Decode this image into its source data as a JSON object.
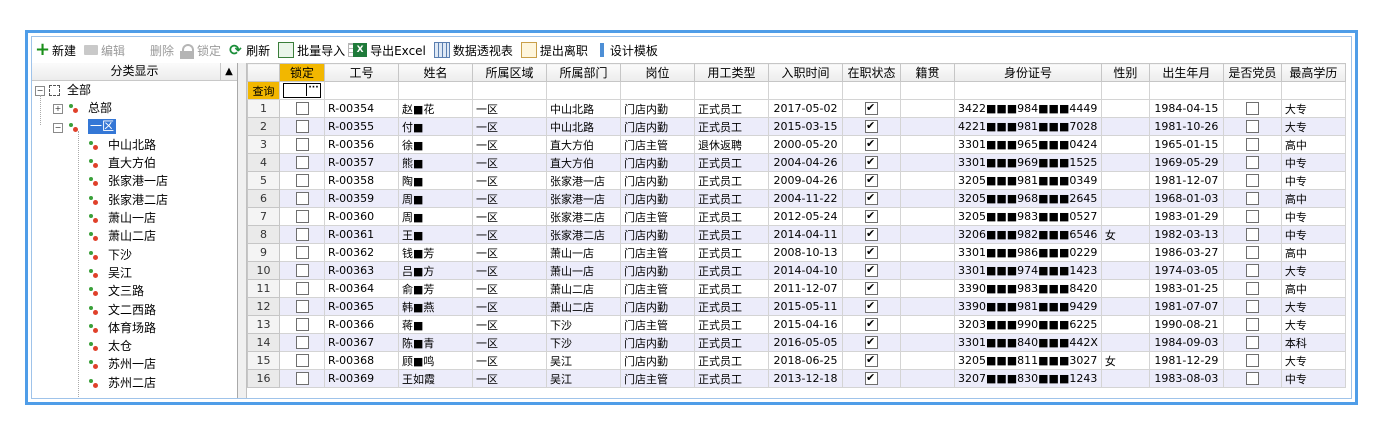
{
  "toolbar": {
    "new": "新建",
    "edit": "编辑",
    "delete": "删除",
    "lock": "锁定",
    "refresh": "刷新",
    "import": "批量导入",
    "export": "导出Excel",
    "pivot": "数据透视表",
    "leave": "提出离职",
    "template": "设计模板"
  },
  "tree": {
    "header": "分类显示",
    "root": "全部",
    "hq": "总部",
    "region1": "一区",
    "stores": [
      "中山北路",
      "直大方伯",
      "张家港一店",
      "张家港二店",
      "萧山一店",
      "萧山二店",
      "下沙",
      "吴江",
      "文三路",
      "文二西路",
      "体育场路",
      "太仓",
      "苏州一店",
      "苏州二店"
    ]
  },
  "grid": {
    "columns": [
      "锁定",
      "工号",
      "姓名",
      "所属区域",
      "所属部门",
      "岗位",
      "用工类型",
      "入职时间",
      "在职状态",
      "籍贯",
      "身份证号",
      "性别",
      "出生年月",
      "是否党员",
      "最高学历"
    ],
    "query_label": "查询",
    "rows": [
      {
        "n": "1",
        "id": "R-00354",
        "name": "赵■花",
        "region": "一区",
        "dept": "中山北路",
        "post": "门店内勤",
        "type": "正式员工",
        "date": "2017-05-02",
        "active": true,
        "native": "",
        "idno": "3422■■■984■■■4449",
        "sex": "",
        "birth": "1984-04-15",
        "party": false,
        "edu": "大专"
      },
      {
        "n": "2",
        "id": "R-00355",
        "name": "付■",
        "region": "一区",
        "dept": "中山北路",
        "post": "门店内勤",
        "type": "正式员工",
        "date": "2015-03-15",
        "active": true,
        "native": "",
        "idno": "4221■■■981■■■7028",
        "sex": "",
        "birth": "1981-10-26",
        "party": false,
        "edu": "大专"
      },
      {
        "n": "3",
        "id": "R-00356",
        "name": "徐■",
        "region": "一区",
        "dept": "直大方伯",
        "post": "门店主管",
        "type": "退休返聘",
        "date": "2000-05-20",
        "active": true,
        "native": "",
        "idno": "3301■■■965■■■0424",
        "sex": "",
        "birth": "1965-01-15",
        "party": false,
        "edu": "高中"
      },
      {
        "n": "4",
        "id": "R-00357",
        "name": "熊■",
        "region": "一区",
        "dept": "直大方伯",
        "post": "门店内勤",
        "type": "正式员工",
        "date": "2004-04-26",
        "active": true,
        "native": "",
        "idno": "3301■■■969■■■1525",
        "sex": "",
        "birth": "1969-05-29",
        "party": false,
        "edu": "中专"
      },
      {
        "n": "5",
        "id": "R-00358",
        "name": "陶■",
        "region": "一区",
        "dept": "张家港一店",
        "post": "门店内勤",
        "type": "正式员工",
        "date": "2009-04-26",
        "active": true,
        "native": "",
        "idno": "3205■■■981■■■0349",
        "sex": "",
        "birth": "1981-12-07",
        "party": false,
        "edu": "中专"
      },
      {
        "n": "6",
        "id": "R-00359",
        "name": "周■",
        "region": "一区",
        "dept": "张家港一店",
        "post": "门店内勤",
        "type": "正式员工",
        "date": "2004-11-22",
        "active": true,
        "native": "",
        "idno": "3205■■■968■■■2645",
        "sex": "",
        "birth": "1968-01-03",
        "party": false,
        "edu": "高中"
      },
      {
        "n": "7",
        "id": "R-00360",
        "name": "周■",
        "region": "一区",
        "dept": "张家港二店",
        "post": "门店主管",
        "type": "正式员工",
        "date": "2012-05-24",
        "active": true,
        "native": "",
        "idno": "3205■■■983■■■0527",
        "sex": "",
        "birth": "1983-01-29",
        "party": false,
        "edu": "中专"
      },
      {
        "n": "8",
        "id": "R-00361",
        "name": "王■",
        "region": "一区",
        "dept": "张家港二店",
        "post": "门店内勤",
        "type": "正式员工",
        "date": "2014-04-11",
        "active": true,
        "native": "",
        "idno": "3206■■■982■■■6546",
        "sex": "女",
        "birth": "1982-03-13",
        "party": false,
        "edu": "中专"
      },
      {
        "n": "9",
        "id": "R-00362",
        "name": "钱■芳",
        "region": "一区",
        "dept": "萧山一店",
        "post": "门店主管",
        "type": "正式员工",
        "date": "2008-10-13",
        "active": true,
        "native": "",
        "idno": "3301■■■986■■■0229",
        "sex": "",
        "birth": "1986-03-27",
        "party": false,
        "edu": "高中"
      },
      {
        "n": "10",
        "id": "R-00363",
        "name": "吕■方",
        "region": "一区",
        "dept": "萧山一店",
        "post": "门店内勤",
        "type": "正式员工",
        "date": "2014-04-10",
        "active": true,
        "native": "",
        "idno": "3301■■■974■■■1423",
        "sex": "",
        "birth": "1974-03-05",
        "party": false,
        "edu": "大专"
      },
      {
        "n": "11",
        "id": "R-00364",
        "name": "俞■芳",
        "region": "一区",
        "dept": "萧山二店",
        "post": "门店主管",
        "type": "正式员工",
        "date": "2011-12-07",
        "active": true,
        "native": "",
        "idno": "3390■■■983■■■8420",
        "sex": "",
        "birth": "1983-01-25",
        "party": false,
        "edu": "高中"
      },
      {
        "n": "12",
        "id": "R-00365",
        "name": "韩■燕",
        "region": "一区",
        "dept": "萧山二店",
        "post": "门店内勤",
        "type": "正式员工",
        "date": "2015-05-11",
        "active": true,
        "native": "",
        "idno": "3390■■■981■■■9429",
        "sex": "",
        "birth": "1981-07-07",
        "party": false,
        "edu": "大专"
      },
      {
        "n": "13",
        "id": "R-00366",
        "name": "蒋■",
        "region": "一区",
        "dept": "下沙",
        "post": "门店主管",
        "type": "正式员工",
        "date": "2015-04-16",
        "active": true,
        "native": "",
        "idno": "3203■■■990■■■6225",
        "sex": "",
        "birth": "1990-08-21",
        "party": false,
        "edu": "大专"
      },
      {
        "n": "14",
        "id": "R-00367",
        "name": "陈■青",
        "region": "一区",
        "dept": "下沙",
        "post": "门店内勤",
        "type": "正式员工",
        "date": "2016-05-05",
        "active": true,
        "native": "",
        "idno": "3301■■■840■■■442X",
        "sex": "",
        "birth": "1984-09-03",
        "party": false,
        "edu": "本科"
      },
      {
        "n": "15",
        "id": "R-00368",
        "name": "顾■鸣",
        "region": "一区",
        "dept": "吴江",
        "post": "门店内勤",
        "type": "正式员工",
        "date": "2018-06-25",
        "active": true,
        "native": "",
        "idno": "3205■■■811■■■3027",
        "sex": "女",
        "birth": "1981-12-29",
        "party": false,
        "edu": "大专"
      },
      {
        "n": "16",
        "id": "R-00369",
        "name": "王如霞",
        "region": "一区",
        "dept": "吴江",
        "post": "门店主管",
        "type": "正式员工",
        "date": "2013-12-18",
        "active": true,
        "native": "",
        "idno": "3207■■■830■■■1243",
        "sex": "",
        "birth": "1983-08-03",
        "party": false,
        "edu": "中专"
      }
    ]
  }
}
